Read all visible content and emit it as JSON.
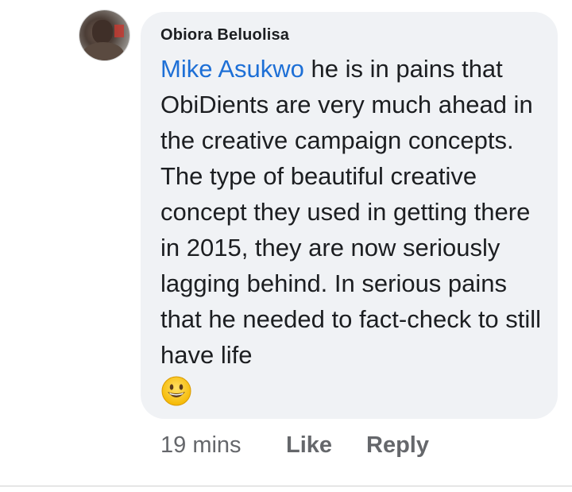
{
  "comment": {
    "author_name": "Obiora Beluolisa",
    "mention": "Mike Asukwo",
    "body_text": " he is in pains that ObiDients are very much ahead in the creative campaign concepts.  The type of beautiful creative concept they used in getting there in 2015, they are now seriously lagging behind. In serious pains that he needed to fact-check to still have life",
    "emoji": "grinning-face-emoji",
    "timestamp": "19 mins",
    "like_label": "Like",
    "reply_label": "Reply"
  },
  "colors": {
    "mention_blue": "#1d6fd6",
    "bubble_bg": "#f0f2f5",
    "meta_gray": "#65676b",
    "text_dark": "#1c1e21"
  }
}
